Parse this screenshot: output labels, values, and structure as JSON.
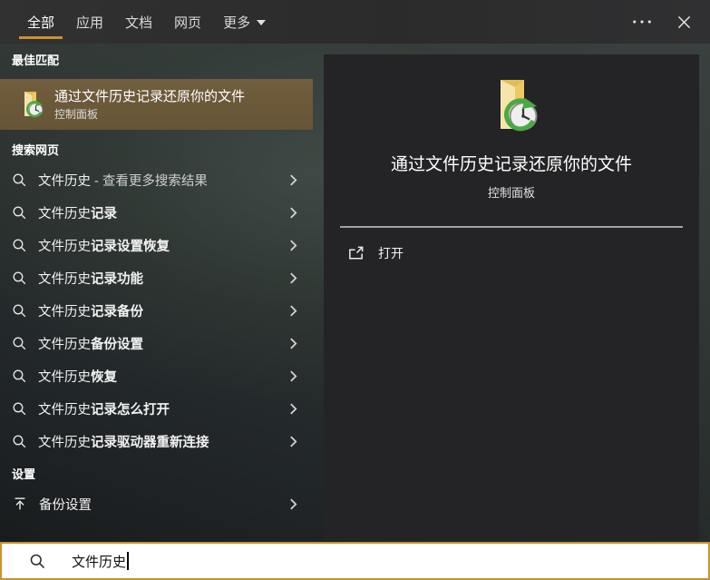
{
  "colors": {
    "accent": "#c9912f",
    "highlight": "#6b5939",
    "preview_bg": "#242426"
  },
  "tabs": {
    "items": [
      {
        "label": "全部",
        "selected": true
      },
      {
        "label": "应用",
        "selected": false
      },
      {
        "label": "文档",
        "selected": false
      },
      {
        "label": "网页",
        "selected": false
      },
      {
        "label": "更多",
        "selected": false,
        "has_dropdown": true
      }
    ]
  },
  "topbar_icons": {
    "more": "ellipsis-icon",
    "close": "x-icon"
  },
  "best_match": {
    "header": "最佳匹配",
    "title": "通过文件历史记录还原你的文件",
    "subtitle": "控制面板",
    "icon": "file-history-folder-clock"
  },
  "web_search": {
    "header": "搜索网页",
    "item_icon": "magnifier",
    "chevron_icon": "chevron-right",
    "items": [
      {
        "query": "文件历史",
        "completion": " - 查看更多搜索结果"
      },
      {
        "query": "文件历史",
        "completion": "记录"
      },
      {
        "query": "文件历史",
        "completion": "记录设置恢复"
      },
      {
        "query": "文件历史",
        "completion": "记录功能"
      },
      {
        "query": "文件历史",
        "completion": "记录备份"
      },
      {
        "query": "文件历史",
        "completion": "备份设置"
      },
      {
        "query": "文件历史",
        "completion": "恢复"
      },
      {
        "query": "文件历史",
        "completion": "记录怎么打开"
      },
      {
        "query": "文件历史",
        "completion": "记录驱动器重新连接"
      }
    ]
  },
  "settings": {
    "header": "设置",
    "items": [
      {
        "label": "备份设置",
        "icon": "backup-arrow-up"
      }
    ]
  },
  "preview": {
    "icon": "file-history-folder-clock",
    "title": "通过文件历史记录还原你的文件",
    "subtitle": "控制面板",
    "actions": [
      {
        "label": "打开",
        "icon": "open-external"
      }
    ]
  },
  "search": {
    "value": "文件历史",
    "icon": "magnifier"
  }
}
